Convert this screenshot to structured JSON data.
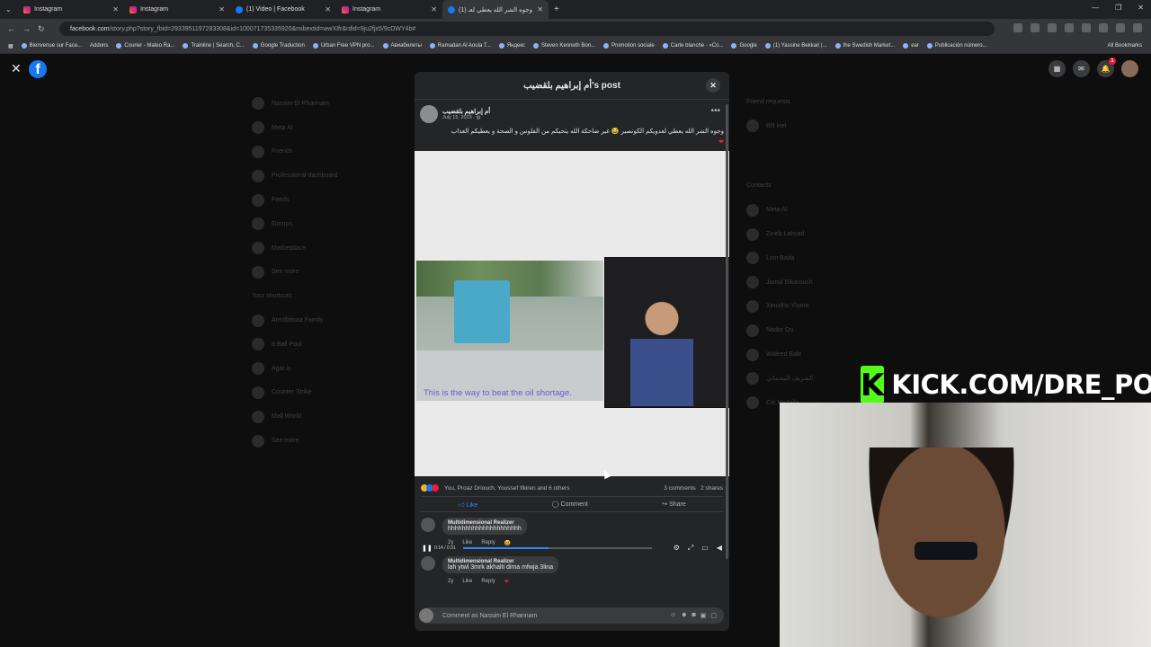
{
  "tabs": [
    {
      "label": "Instagram",
      "type": "instagram"
    },
    {
      "label": "Instagram",
      "type": "instagram"
    },
    {
      "label": "(1) Video | Facebook",
      "type": "facebook"
    },
    {
      "label": "Instagram",
      "type": "instagram"
    },
    {
      "label": "(1) وجوه الشر الله يعطي لعـ",
      "type": "facebook",
      "active": true
    }
  ],
  "address": {
    "host": "facebook.com",
    "path": "/story.php?story_fbid=2933951197283308&id=100071735335920&mibextid=wwXIfr&rdid=9ju2fjx5/9cDWY4b#"
  },
  "bookmarks": [
    "Bienvenue sur Face...",
    "Addons",
    "Courier - Mateo Ra...",
    "Trainline | Search, C...",
    "Google Traduction",
    "Urban Free VPN pro...",
    "Авиабилеты",
    "Ramadan Al Aoula T...",
    "Яндекс",
    "Steven Kenneth Bon...",
    "Promotion sociale",
    "Carte blanche - «Co...",
    "Google",
    "(1) Yassine Bekkari |...",
    "the Swedish Market...",
    "ear",
    "Publicación número..."
  ],
  "all_bookmarks": "All Bookmarks",
  "nav_left": [
    "Nassim El Rhannam",
    "Meta AI",
    "Friends",
    "Professional dashboard",
    "Feeds",
    "Groups",
    "Marketplace",
    "See more",
    "Your shortcuts",
    "Armilbibiaa Family",
    "8 Ball Pool",
    "Agar.io",
    "Counter Strike",
    "Mall World",
    "See more"
  ],
  "nav_right": [
    "Friend requests",
    "Bilt Hel",
    "Contacts",
    "Meta AI",
    "Zineb Labyad",
    "Lion Bada",
    "Jamal Elkarouch",
    "Xenolho Ylome",
    "Nader Ou",
    "Waleed Bale",
    "الشريف البيجماني",
    "Cin Hadaifa"
  ],
  "modal": {
    "title": "أم إبراهيم بلقضيب's post",
    "author": "أم إبراهيم بلقضيب",
    "date": "July 15, 2023 · ",
    "caption": "وجوه الشر الله يعطي لعدويكم الكونصير 😂 غير ضاحكة الله يتحيكم من الفلوس و الصحة و يعطيكم العذاب",
    "video_subtitle": "This is the way to beat the oil shortage.",
    "video_time": "0:14 / 0:31",
    "video_progress": 0.45,
    "reactions_text": "You, Proaz Driouch, Youssef Ifkiren and 6 others",
    "comments_count": "3 comments",
    "shares_count": "2 shares",
    "like_label": "Like",
    "comment_label": "Comment",
    "share_label": "Share",
    "comments": [
      {
        "name": "Multidimensional Realizer",
        "text": "hhhhhhhhhhhhhhhhhhhhh",
        "age": "2y",
        "like": "Like",
        "reply": "Reply"
      },
      {
        "name": "Multidimensional Realizer",
        "text": "lah ytwl 3mrk akhalti dima mfwja 3lina",
        "age": "2y",
        "like": "Like",
        "reply": "Reply"
      }
    ],
    "comment_placeholder": "Comment as Nassim El Rhannam"
  },
  "overlay": {
    "kick_text": "KICK.COM/DRE_POP"
  },
  "colors": {
    "accent": "#1877f2",
    "kick": "#53fc18"
  }
}
